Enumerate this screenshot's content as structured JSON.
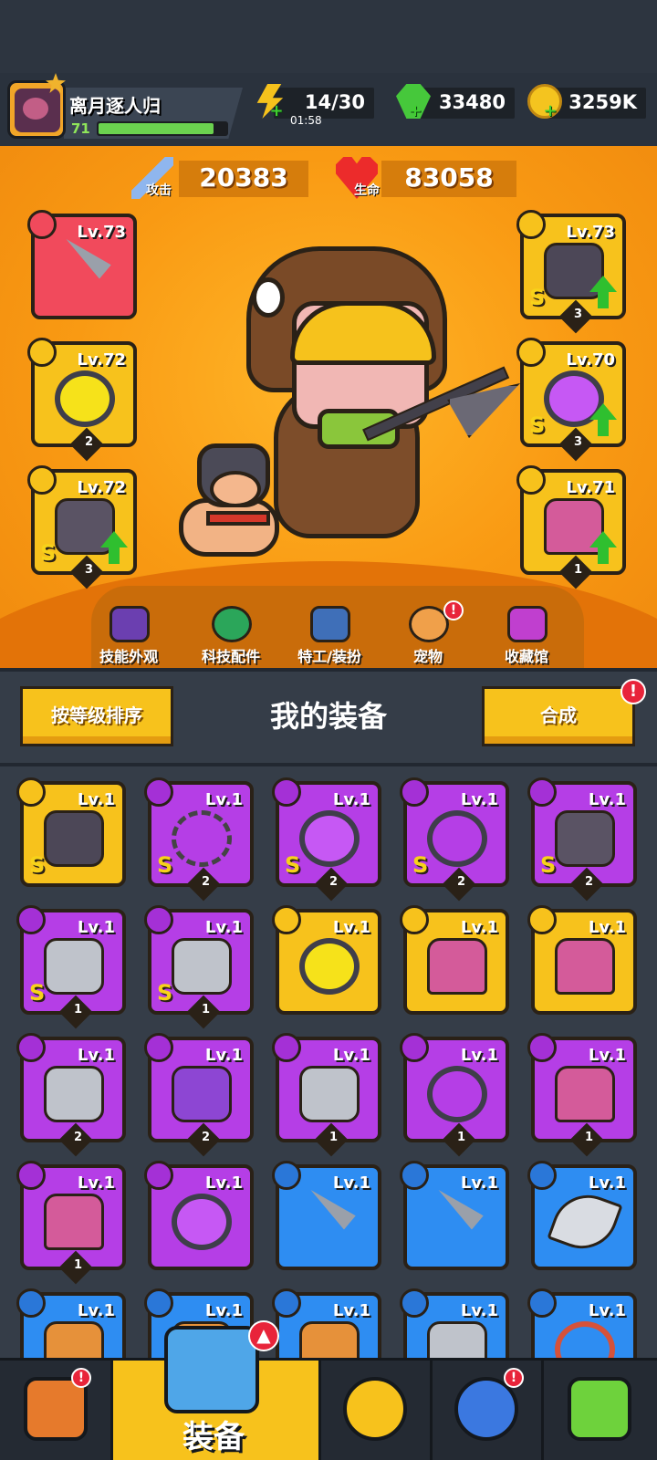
{
  "player": {
    "name": "离月逐人归",
    "level": "71",
    "xp_fraction": 0.9
  },
  "resources": {
    "energy": {
      "value": "14/30",
      "timer": "01:58"
    },
    "gems": {
      "value": "33480"
    },
    "coins": {
      "value": "3259K"
    }
  },
  "stats": {
    "attack": {
      "label": "攻击",
      "value": "20383"
    },
    "health": {
      "label": "生命",
      "value": "83058"
    }
  },
  "equipped_left": [
    {
      "slot": "weapon",
      "level": "Lv.73",
      "color": "red",
      "item": "knife"
    },
    {
      "slot": "necklace",
      "level": "Lv.72",
      "color": "gold",
      "item": "ring yellow-core",
      "count": "2"
    },
    {
      "slot": "gloves",
      "level": "Lv.72",
      "color": "gold",
      "item": "glove",
      "rank": "S",
      "count": "3",
      "upgrade": true
    }
  ],
  "equipped_right": [
    {
      "slot": "armor",
      "level": "Lv.73",
      "color": "gold",
      "item": "armor",
      "rank": "S",
      "count": "3",
      "upgrade": true
    },
    {
      "slot": "belt",
      "level": "Lv.70",
      "color": "gold",
      "item": "ring purple-core",
      "rank": "S",
      "count": "3",
      "upgrade": true
    },
    {
      "slot": "boots",
      "level": "Lv.71",
      "color": "gold",
      "item": "boot",
      "count": "1",
      "upgrade": true
    }
  ],
  "menu": [
    {
      "label": "技能外观",
      "badge": false
    },
    {
      "label": "科技配件",
      "badge": false
    },
    {
      "label": "特工/装扮",
      "badge": false
    },
    {
      "label": "宠物",
      "badge": true
    },
    {
      "label": "收藏馆",
      "badge": false
    }
  ],
  "panel": {
    "sort_label": "按等级排序",
    "title": "我的装备",
    "merge_label": "合成"
  },
  "inventory": [
    {
      "level": "Lv.1",
      "color": "gold",
      "item": "armor",
      "rank": "S"
    },
    {
      "level": "Lv.1",
      "color": "purple",
      "item": "chain",
      "rank": "S",
      "count": "2"
    },
    {
      "level": "Lv.1",
      "color": "purple",
      "item": "ring purple-core",
      "rank": "S",
      "count": "2"
    },
    {
      "level": "Lv.1",
      "color": "purple",
      "item": "ring",
      "rank": "S",
      "count": "2"
    },
    {
      "level": "Lv.1",
      "color": "purple",
      "item": "glove",
      "rank": "S",
      "count": "2"
    },
    {
      "level": "Lv.1",
      "color": "purple",
      "item": "armor silver",
      "rank": "S",
      "count": "1"
    },
    {
      "level": "Lv.1",
      "color": "purple",
      "item": "armor silver",
      "rank": "S",
      "count": "1"
    },
    {
      "level": "Lv.1",
      "color": "gold",
      "item": "ring yellow-core"
    },
    {
      "level": "Lv.1",
      "color": "gold",
      "item": "boot"
    },
    {
      "level": "Lv.1",
      "color": "gold",
      "item": "boot"
    },
    {
      "level": "Lv.1",
      "color": "purple",
      "item": "armor silver",
      "count": "2"
    },
    {
      "level": "Lv.1",
      "color": "purple",
      "item": "glove purple",
      "count": "2"
    },
    {
      "level": "Lv.1",
      "color": "purple",
      "item": "armor silver",
      "count": "1"
    },
    {
      "level": "Lv.1",
      "color": "purple",
      "item": "ring",
      "count": "1"
    },
    {
      "level": "Lv.1",
      "color": "purple",
      "item": "boot",
      "count": "1"
    },
    {
      "level": "Lv.1",
      "color": "purple",
      "item": "boot",
      "count": "1"
    },
    {
      "level": "Lv.1",
      "color": "purple",
      "item": "ring purple-core"
    },
    {
      "level": "Lv.1",
      "color": "blue",
      "item": "knife"
    },
    {
      "level": "Lv.1",
      "color": "blue",
      "item": "knife"
    },
    {
      "level": "Lv.1",
      "color": "blue",
      "item": "blade"
    },
    {
      "level": "Lv.1",
      "color": "blue",
      "item": "hat"
    },
    {
      "level": "Lv.1",
      "color": "blue",
      "item": "hat"
    },
    {
      "level": "Lv.1",
      "color": "blue",
      "item": "hat"
    },
    {
      "level": "Lv.1",
      "color": "blue",
      "item": "armor silver"
    },
    {
      "level": "Lv.1",
      "color": "blue",
      "item": "rope"
    }
  ],
  "nav": [
    {
      "name": "shop",
      "badge": true
    },
    {
      "name": "equipment",
      "label": "装备",
      "active": true
    },
    {
      "name": "battle",
      "badge": false
    },
    {
      "name": "events",
      "badge": true
    },
    {
      "name": "evolution",
      "badge": false
    }
  ],
  "colors": {
    "orange_bg": "#f99a13",
    "gold": "#f7c21c",
    "purple": "#b53ee6",
    "blue": "#2e8df2",
    "red": "#f14a5c",
    "badge": "#e8243a"
  }
}
